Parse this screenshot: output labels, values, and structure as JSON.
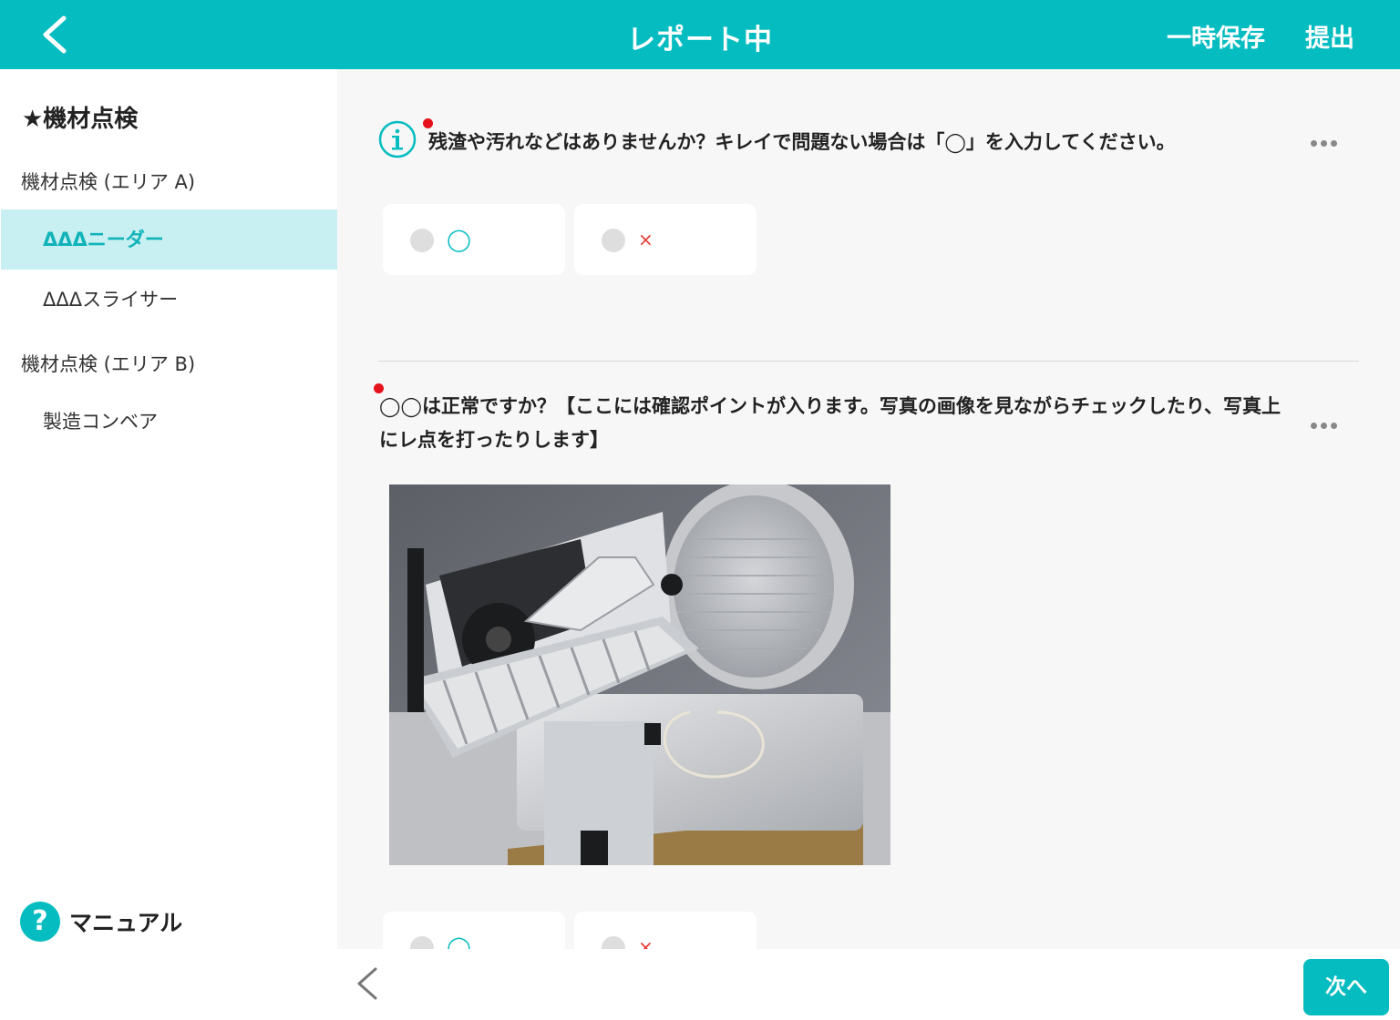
{
  "header": {
    "title": "レポート中",
    "save_label": "一時保存",
    "submit_label": "提出"
  },
  "sidebar": {
    "section_title": "★機材点検",
    "groups": [
      {
        "label": "機材点検 (エリア A)",
        "items": [
          {
            "label": "ΔΔΔニーダー",
            "active": true
          },
          {
            "label": "ΔΔΔスライサー",
            "active": false
          }
        ]
      },
      {
        "label": "機材点検 (エリア B)",
        "items": [
          {
            "label": "製造コンベア",
            "active": false
          }
        ]
      }
    ],
    "manual_icon": "?",
    "manual_label": "マニュアル"
  },
  "questions": [
    {
      "text": "残渣や汚れなどはありませんか？キレイで問題ない場合は「◯」を入力してください。",
      "options": [
        "◯",
        "×"
      ],
      "required": true
    },
    {
      "text": "◯◯は正常ですか？【ここには確認ポイントが入ります。写真の画像を見ながらチェックしたり、写真上にレ点を打ったりします】",
      "options": [
        "◯",
        "×"
      ],
      "required": true
    }
  ],
  "footer": {
    "next_label": "次へ"
  },
  "colors": {
    "accent": "#05bcc0",
    "active_bg": "#c8eff1",
    "required_dot": "#e5121b",
    "cross": "#e53935"
  }
}
